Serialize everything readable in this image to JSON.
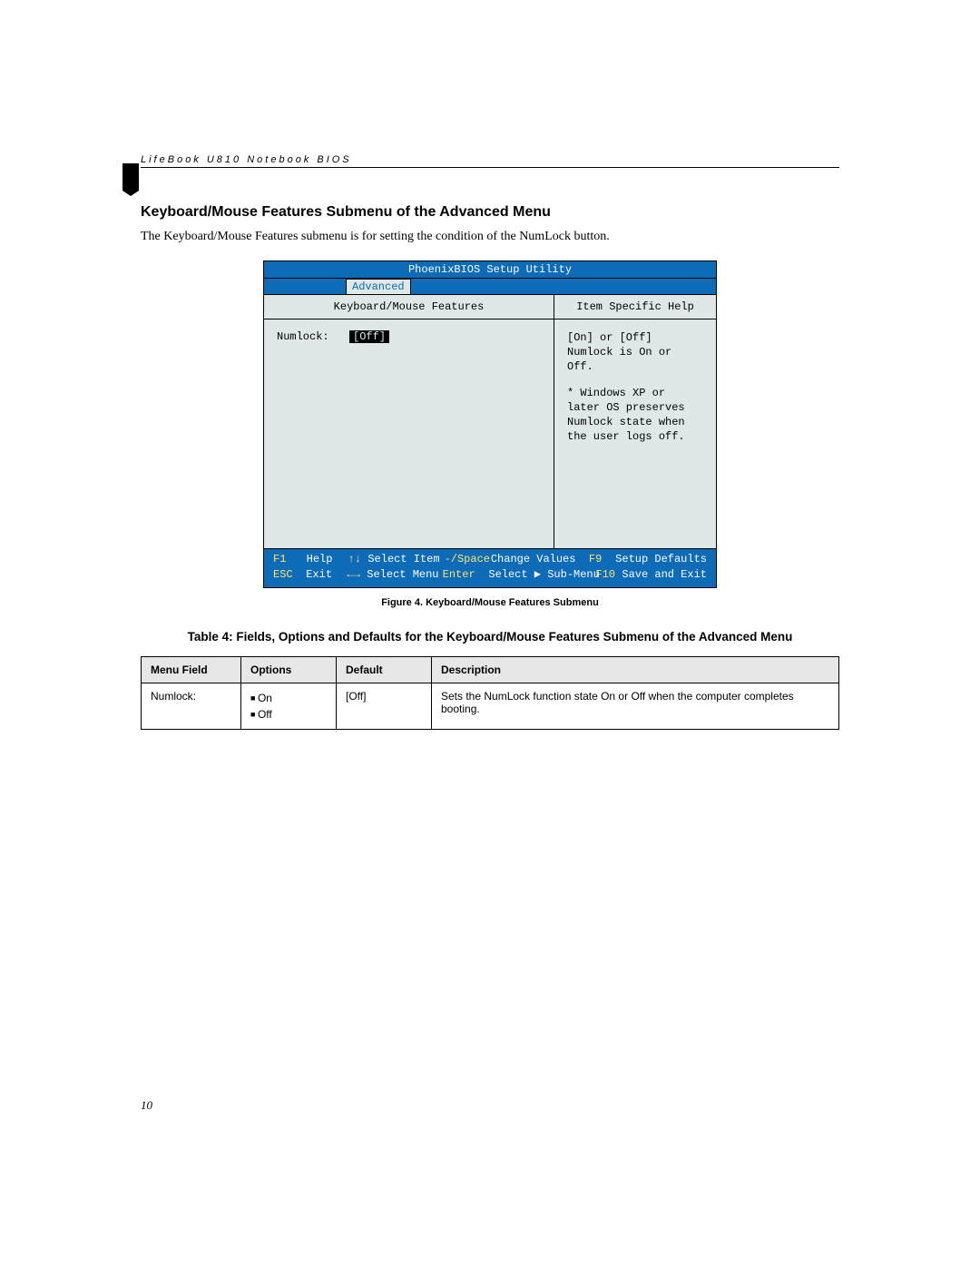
{
  "header": {
    "running_head": "LifeBook U810 Notebook BIOS"
  },
  "section": {
    "title": "Keyboard/Mouse Features Submenu of the Advanced Menu",
    "intro": "The Keyboard/Mouse Features submenu is for setting the condition of the NumLock button."
  },
  "bios": {
    "title": "PhoenixBIOS Setup Utility",
    "active_tab": "Advanced",
    "left_heading": "Keyboard/Mouse Features",
    "right_heading": "Item Specific Help",
    "setting_label": "Numlock:",
    "setting_value": "[Off]",
    "help_line1": "[On] or [Off]",
    "help_line2": "Numlock is On or Off.",
    "help_line3": "* Windows XP or later OS preserves Numlock state when the user logs off.",
    "footer": {
      "r1c1": "F1",
      "r1c2": "Help",
      "r1c3": "↑↓",
      "r1c4": "Select Item",
      "r1c5": "-/Space",
      "r1c6": "Change Values",
      "r1c7": "F9",
      "r1c8": "Setup Defaults",
      "r2c1": "ESC",
      "r2c2": "Exit",
      "r2c3": "←→",
      "r2c4": "Select Menu",
      "r2c5": "Enter",
      "r2c6": "Select ▶ Sub-Menu",
      "r2c7": "F10",
      "r2c8": "Save and Exit"
    }
  },
  "figure_caption": "Figure 4.   Keyboard/Mouse Features Submenu",
  "table_caption": "Table 4: Fields, Options and Defaults for the Keyboard/Mouse Features Submenu of the Advanced Menu",
  "table": {
    "headers": {
      "c1": "Menu Field",
      "c2": "Options",
      "c3": "Default",
      "c4": "Description"
    },
    "row1": {
      "field": "Numlock:",
      "opt1": "On",
      "opt2": "Off",
      "default": "[Off]",
      "desc": "Sets the NumLock function state On or Off when the computer completes booting."
    }
  },
  "page_number": "10"
}
